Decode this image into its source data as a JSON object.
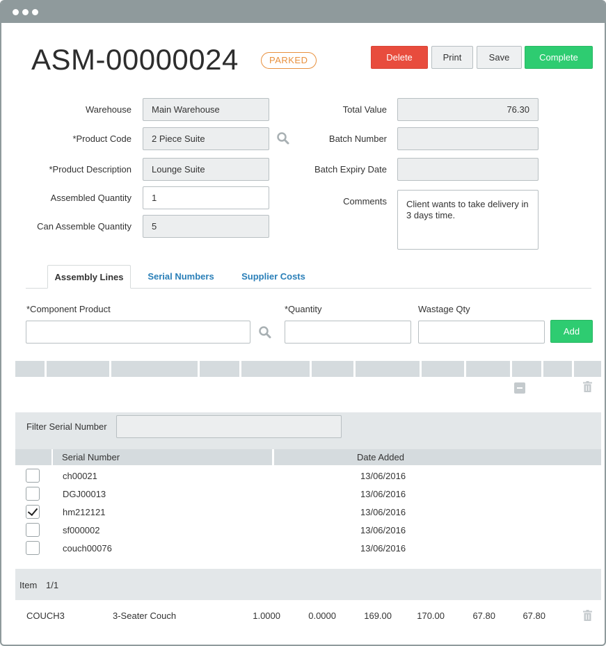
{
  "page": {
    "title": "ASM-00000024",
    "status": "PARKED"
  },
  "toolbar": {
    "delete_label": "Delete",
    "print_label": "Print",
    "save_label": "Save",
    "complete_label": "Complete"
  },
  "form": {
    "warehouse_label": "Warehouse",
    "warehouse_value": "Main Warehouse",
    "product_code_label": "*Product Code",
    "product_code_value": "2 Piece Suite",
    "product_description_label": "*Product Description",
    "product_description_value": "Lounge Suite",
    "assembled_quantity_label": "Assembled Quantity",
    "assembled_quantity_value": "1",
    "can_assemble_quantity_label": "Can Assemble Quantity",
    "can_assemble_quantity_value": "5",
    "total_value_label": "Total Value",
    "total_value_value": "76.30",
    "batch_number_label": "Batch Number",
    "batch_number_value": "",
    "batch_expiry_label": "Batch Expiry Date",
    "batch_expiry_value": "",
    "comments_label": "Comments",
    "comments_value": "Client wants to take delivery in 3 days time."
  },
  "tabs": [
    {
      "label": "Assembly Lines",
      "active": true
    },
    {
      "label": "Serial Numbers",
      "active": false
    },
    {
      "label": "Supplier Costs",
      "active": false
    }
  ],
  "line_entry": {
    "component_product_label": "*Component Product",
    "quantity_label": "*Quantity",
    "wastage_qty_label": "Wastage Qty",
    "add_label": "Add"
  },
  "serials": {
    "filter_label": "Filter Serial Number",
    "filter_value": "",
    "columns": [
      "Serial Number",
      "Date Added"
    ],
    "rows": [
      {
        "serial": "ch00021",
        "date": "13/06/2016",
        "checked": false
      },
      {
        "serial": "DGJ00013",
        "date": "13/06/2016",
        "checked": false
      },
      {
        "serial": "hm212121",
        "date": "13/06/2016",
        "checked": true
      },
      {
        "serial": "sf000002",
        "date": "13/06/2016",
        "checked": false
      },
      {
        "serial": "couch00076",
        "date": "13/06/2016",
        "checked": false
      }
    ]
  },
  "item_bar": {
    "label": "Item",
    "count": "1/1"
  },
  "line_item": {
    "code": "COUCH3",
    "description": "3-Seater Couch",
    "col1": "1.0000",
    "col2": "0.0000",
    "col3": "169.00",
    "col4": "170.00",
    "col5": "67.80",
    "col6": "67.80"
  },
  "colors": {
    "danger": "#e84c3d",
    "success": "#2ecc71",
    "warning": "#e8903d",
    "link": "#2a7fb8"
  }
}
